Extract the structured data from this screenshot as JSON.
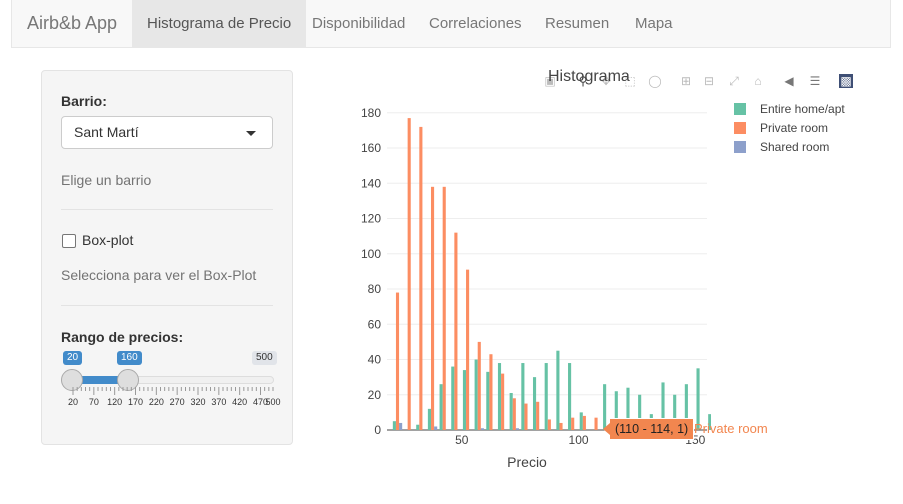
{
  "navbar": {
    "brand": "Airb&b App",
    "tabs": [
      "Histograma de Precio",
      "Disponibilidad",
      "Correlaciones",
      "Resumen",
      "Mapa"
    ]
  },
  "sidebar": {
    "barrio_label": "Barrio:",
    "barrio_value": "Sant Martí",
    "barrio_help": "Elige un barrio",
    "boxplot_label": "Box-plot",
    "boxplot_checked": false,
    "boxplot_help": "Selecciona para ver el Box-Plot",
    "range_label": "Rango de precios:",
    "range_from": "20",
    "range_to": "160",
    "range_max": "500",
    "range_ticks": [
      "20",
      "70",
      "120",
      "170",
      "220",
      "270",
      "320",
      "370",
      "420",
      "470",
      "500"
    ]
  },
  "plot": {
    "title": "Histograma",
    "toolbar_icons": [
      "camera-icon",
      "zoom-icon",
      "pan-icon",
      "box-select-icon",
      "lasso-icon",
      "zoom-in-icon",
      "zoom-out-icon",
      "autoscale-icon",
      "home-icon",
      "spike-lines-icon",
      "compare-icon",
      "plotly-logo-icon"
    ],
    "tooltip_value": "(110 - 114, 1)",
    "tooltip_series": "Private room"
  },
  "chart_data": {
    "type": "bar",
    "title": "Histograma",
    "xlabel": "Precio",
    "ylabel": "",
    "xlim": [
      18,
      155
    ],
    "ylim": [
      0,
      185
    ],
    "x_ticks": [
      "50",
      "100",
      "150"
    ],
    "y_ticks": [
      "0",
      "20",
      "40",
      "60",
      "80",
      "100",
      "120",
      "140",
      "160",
      "180"
    ],
    "bin_width": 5,
    "bins": [
      20,
      25,
      30,
      35,
      40,
      45,
      50,
      55,
      60,
      65,
      70,
      75,
      80,
      85,
      90,
      95,
      100,
      105,
      110,
      115,
      120,
      125,
      130,
      135,
      140,
      145,
      150,
      155
    ],
    "series": [
      {
        "name": "Entire home/apt",
        "color": "#66c2a5",
        "values": [
          5,
          0,
          3,
          12,
          26,
          36,
          34,
          40,
          33,
          38,
          21,
          38,
          30,
          38,
          45,
          38,
          10,
          0,
          26,
          22,
          24,
          20,
          9,
          27,
          20,
          26,
          35,
          9
        ]
      },
      {
        "name": "Private room",
        "color": "#fc8d62",
        "values": [
          78,
          177,
          172,
          138,
          138,
          112,
          91,
          50,
          43,
          32,
          18,
          15,
          16,
          6,
          4,
          7,
          8,
          7,
          1,
          1,
          0,
          0,
          0,
          0,
          0,
          0,
          0,
          0
        ]
      },
      {
        "name": "Shared room",
        "color": "#8da0cb",
        "values": [
          4,
          0,
          0,
          2,
          0,
          0,
          0,
          1,
          0,
          0,
          1,
          0,
          0,
          0,
          0,
          0,
          0,
          0,
          0,
          0,
          0,
          0,
          0,
          0,
          0,
          0,
          0,
          0
        ]
      }
    ],
    "legend_position": "top-right",
    "grid": true
  }
}
